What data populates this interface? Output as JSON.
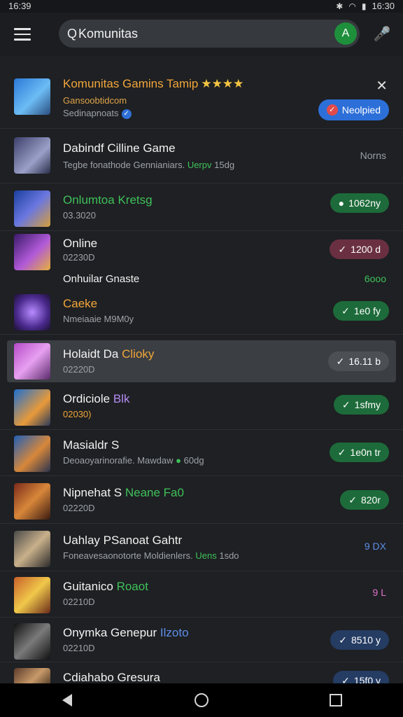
{
  "status": {
    "time_left": "16:39",
    "time_right": "16:30"
  },
  "search": {
    "value": "Komunitas",
    "go_icon": "A"
  },
  "featured": {
    "title": "Komunitas Gamins Tamip",
    "stars": "★★★★",
    "subtitle1": "Gansoobtidcom",
    "subtitle2": "Sedinapnoats",
    "button": "Neolpied"
  },
  "items": [
    {
      "title": "Dabindf Cilline Game",
      "sub": "Tegbe fonathode Gennianiars.",
      "sub_extra": "Uerpv",
      "sub_tail": "15dg",
      "right": "Norns",
      "style": "ghost"
    },
    {
      "title": "Onlumtoa",
      "title_extra": "Kretsg",
      "sub": "03.3020",
      "right": "1062ny",
      "style": "green"
    },
    {
      "title": "Online",
      "sub": "02230D",
      "right": "1200 d",
      "style": "maroon"
    },
    {
      "title": "Onhuilar Gnaste",
      "sub": "",
      "right": "6ooo",
      "style": "ghost-green"
    },
    {
      "title": "Caeke",
      "sub": "Nmeiaaie M9M0y",
      "right": "1e0 fy",
      "style": "green"
    },
    {
      "title": "Holaidt Da",
      "title_extra": "Clioky",
      "sub": "02220D",
      "right": "16.11 b",
      "style": "grey"
    },
    {
      "title": "Ordiciole",
      "title_extra": "Blk",
      "sub": "02030)",
      "right": "1sfmy",
      "style": "green"
    },
    {
      "title": "Masialdr",
      "title_extra": "S",
      "sub": "Deoaoyarinorafie. Mawdaw",
      "sub_tail": "60dg",
      "right": "1e0n tr",
      "style": "green"
    },
    {
      "title": "Nipnehat S",
      "title_extra": "Neane Fa0",
      "sub": "02220D",
      "right": "820r",
      "style": "green"
    },
    {
      "title": "Uahlay PSanoat Gahtr",
      "sub": "Foneavesaonotorte Moldienlers.",
      "sub_extra": "Uens",
      "sub_tail": "1sdo",
      "right": "9 DX",
      "style": "ghost-blue"
    },
    {
      "title": "Guitanico",
      "title_extra": "Roaot",
      "sub": "02210D",
      "right": "9 L",
      "style": "ghost-pink"
    },
    {
      "title": "Onymka Genepur",
      "title_extra": "Ilzoto",
      "sub": "02210D",
      "right": "8510 y",
      "style": "navy"
    },
    {
      "title": "Cdiahabo Gresura",
      "sub": "",
      "right": "15f0 y",
      "style": "navy"
    }
  ],
  "colors": {
    "accent": "#2d6fd8",
    "green": "#1d6b3a",
    "background": "#1e2023"
  }
}
